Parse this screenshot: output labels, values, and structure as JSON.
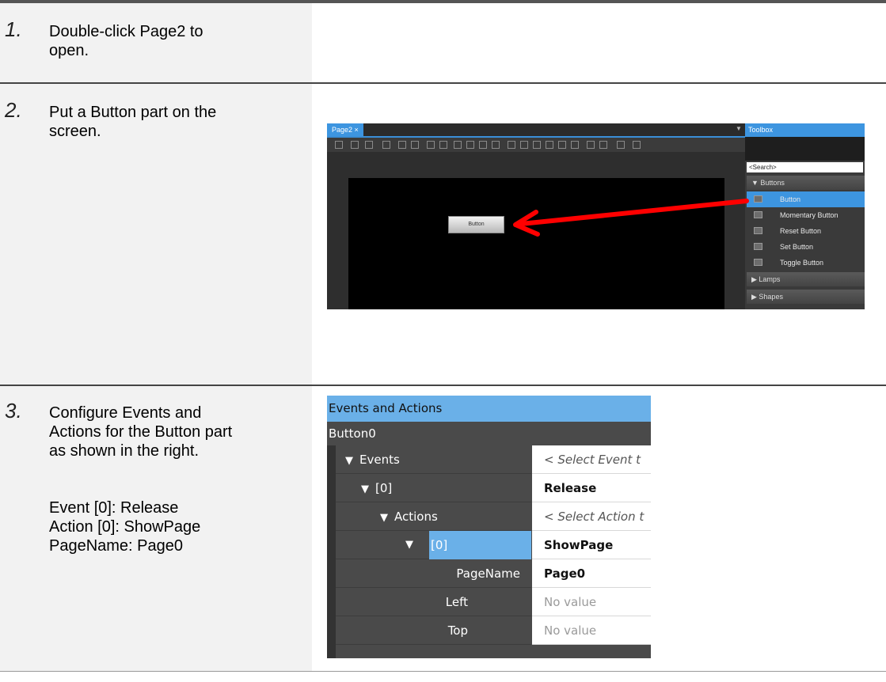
{
  "steps": [
    {
      "num": "1.",
      "text": "Double-click Page2 to\nopen."
    },
    {
      "num": "2.",
      "text": "Put a Button part on the\nscreen."
    },
    {
      "num": "3.",
      "text": "Configure Events and\nActions for the Button part\nas shown in the right.\n\n\nEvent [0]: Release\nAction [0]: ShowPage\nPageName: Page0"
    }
  ],
  "designer": {
    "tab_label": "Page2 ×",
    "button_label": "Button",
    "arrow_color": "#ff0000"
  },
  "toolbox": {
    "title": "Toolbox",
    "search_placeholder": "<Search>",
    "groups": [
      {
        "label": "▼ Buttons"
      },
      {
        "label": "▶ Lamps"
      },
      {
        "label": "▶ Shapes"
      }
    ],
    "items": [
      {
        "label": "Button",
        "selected": true
      },
      {
        "label": "Momentary Button"
      },
      {
        "label": "Reset Button"
      },
      {
        "label": "Set Button"
      },
      {
        "label": "Toggle Button"
      }
    ]
  },
  "events_panel": {
    "title": "Events and Actions",
    "object": "Button0",
    "rows": [
      {
        "name": "Events",
        "value": "< Select Event t"
      },
      {
        "name": "[0]",
        "value": "Release"
      },
      {
        "name": "Actions",
        "value": "< Select Action t"
      },
      {
        "name": "[0]",
        "value": "ShowPage"
      },
      {
        "name": "PageName",
        "value": "Page0"
      },
      {
        "name": "Left",
        "value": "No value"
      },
      {
        "name": "Top",
        "value": "No value"
      }
    ]
  }
}
